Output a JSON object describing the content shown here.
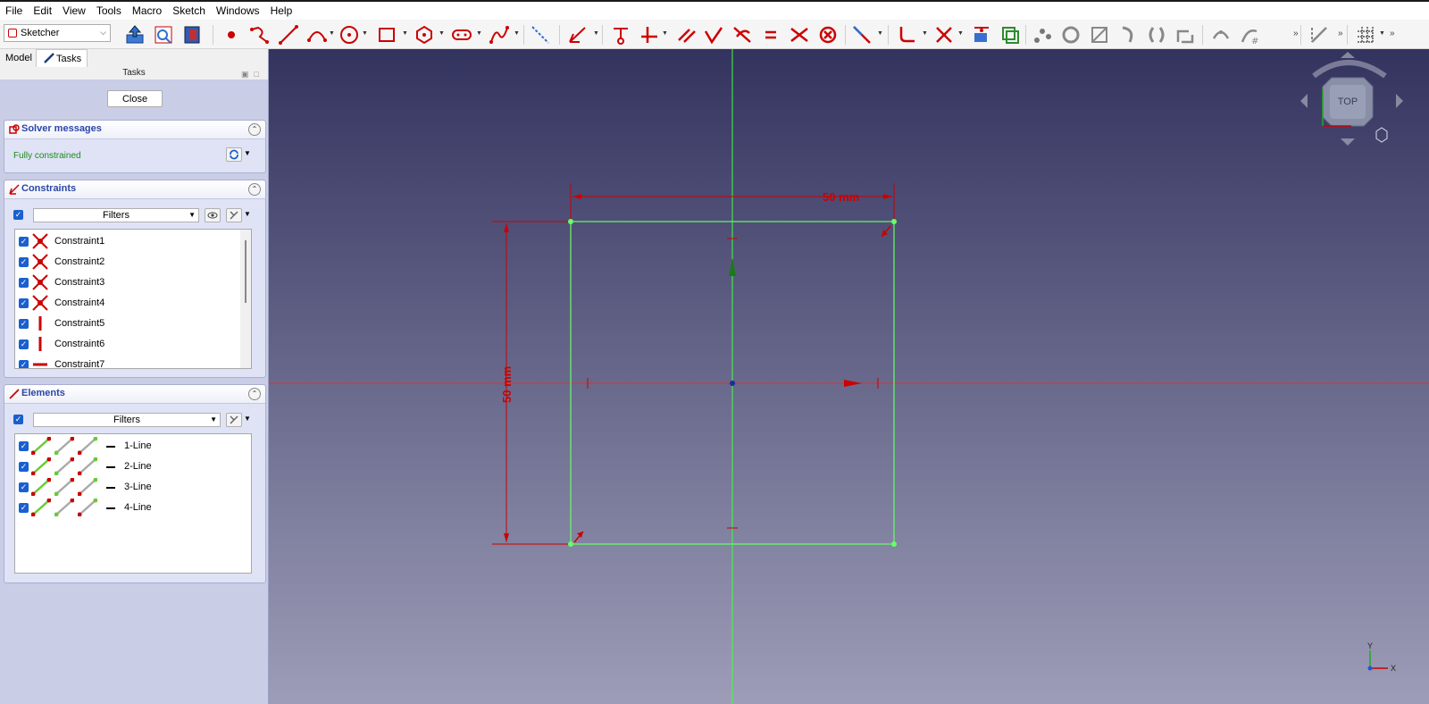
{
  "menu": [
    "File",
    "Edit",
    "View",
    "Tools",
    "Macro",
    "Sketch",
    "Windows",
    "Help"
  ],
  "workbench": "Sketcher",
  "tabs": {
    "model": "Model",
    "tasks": "Tasks"
  },
  "tasks_title": "Tasks",
  "close_label": "Close",
  "solver": {
    "title": "Solver messages",
    "status": "Fully constrained"
  },
  "constraints": {
    "title": "Constraints",
    "filters": "Filters",
    "items": [
      {
        "label": "Constraint1",
        "icon": "coincident"
      },
      {
        "label": "Constraint2",
        "icon": "coincident"
      },
      {
        "label": "Constraint3",
        "icon": "coincident"
      },
      {
        "label": "Constraint4",
        "icon": "coincident"
      },
      {
        "label": "Constraint5",
        "icon": "vertical"
      },
      {
        "label": "Constraint6",
        "icon": "vertical"
      },
      {
        "label": "Constraint7",
        "icon": "horizontal"
      }
    ]
  },
  "elements": {
    "title": "Elements",
    "filters": "Filters",
    "items": [
      "1-Line",
      "2-Line",
      "3-Line",
      "4-Line"
    ]
  },
  "sketch": {
    "dim_horizontal": "50 mm",
    "dim_vertical": "50 mm"
  },
  "navcube": {
    "face": "TOP"
  },
  "axis_labels": {
    "x": "X",
    "y": "Y"
  },
  "colors": {
    "constraint_red": "#c00000",
    "geometry_green": "#66ff66",
    "viewport_top": "#33335f",
    "viewport_bottom": "#9d9db8",
    "accent_blue": "#1a5fd0"
  }
}
